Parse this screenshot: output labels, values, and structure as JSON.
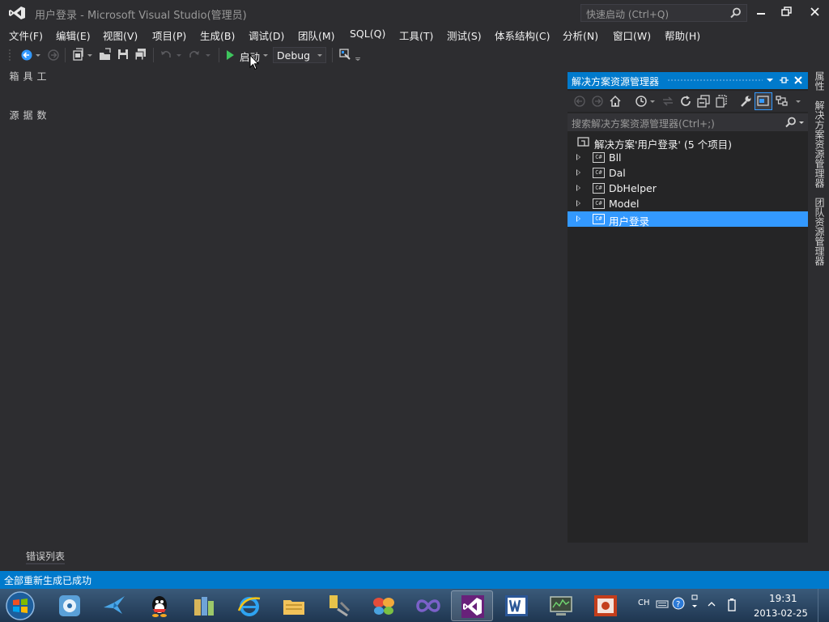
{
  "window": {
    "title": "用户登录 - Microsoft Visual Studio(管理员)",
    "quick_launch_placeholder": "快速启动 (Ctrl+Q)"
  },
  "menu": [
    {
      "label": "文件(F)"
    },
    {
      "label": "编辑(E)"
    },
    {
      "label": "视图(V)"
    },
    {
      "label": "项目(P)"
    },
    {
      "label": "生成(B)"
    },
    {
      "label": "调试(D)"
    },
    {
      "label": "团队(M)"
    },
    {
      "label": "SQL(Q)"
    },
    {
      "label": "工具(T)"
    },
    {
      "label": "测试(S)"
    },
    {
      "label": "体系结构(C)"
    },
    {
      "label": "分析(N)"
    },
    {
      "label": "窗口(W)"
    },
    {
      "label": "帮助(H)"
    }
  ],
  "toolbar": {
    "start_label": "启动",
    "configuration": "Debug"
  },
  "left_tabs": [
    "工具箱",
    "数据源"
  ],
  "right_tabs": [
    "属性",
    "解决方案资源管理器",
    "团队资源管理器"
  ],
  "solution_explorer": {
    "title": "解决方案资源管理器",
    "search_placeholder": "搜索解决方案资源管理器(Ctrl+;)",
    "solution_label": "解决方案'用户登录' (5 个项目)",
    "project_icon_text": "C#",
    "projects": [
      {
        "name": "Bll",
        "selected": false
      },
      {
        "name": "Dal",
        "selected": false
      },
      {
        "name": "DbHelper",
        "selected": false
      },
      {
        "name": "Model",
        "selected": false
      },
      {
        "name": "用户登录",
        "selected": true
      }
    ]
  },
  "bottom_tab": "错误列表",
  "status": "全部重新生成已成功",
  "taskbar": {
    "apps": [
      "media-player-icon",
      "bird-app-icon",
      "qq-icon",
      "library-icon",
      "ie-icon",
      "explorer-icon",
      "tools-icon",
      "butterfly-icon",
      "infinity-icon",
      "visual-studio-icon",
      "word-icon",
      "network-icon",
      "powerpoint-icon"
    ],
    "active_app": "visual-studio-icon",
    "lang": "CH",
    "time": "19:31",
    "date": "2013-02-25"
  },
  "colors": {
    "background": "#2d2d30",
    "accent": "#007acc",
    "selection": "#3399ff"
  }
}
